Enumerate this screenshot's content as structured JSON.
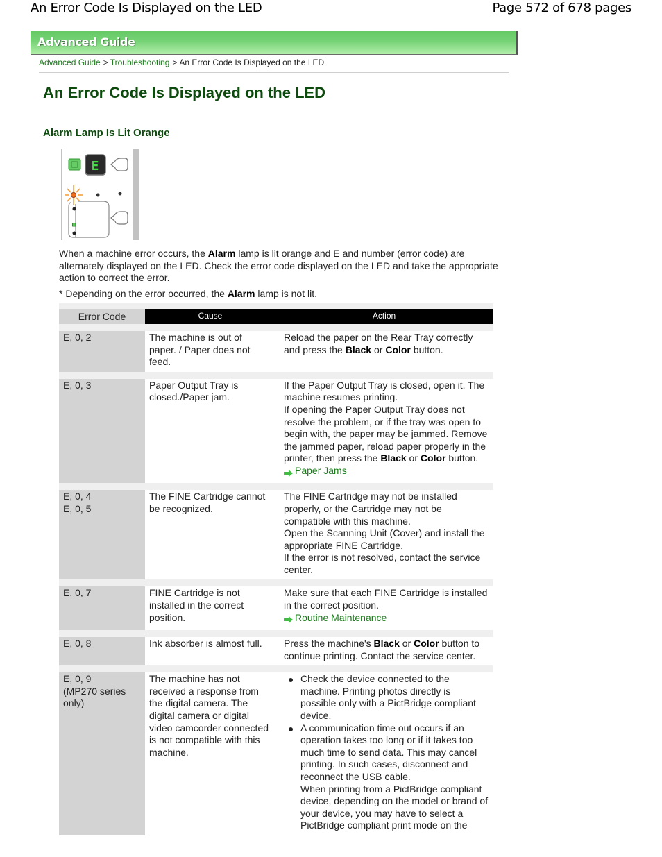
{
  "page_header": {
    "doc_title": "An Error Code Is Displayed on the LED",
    "page_indicator": "Page 572 of 678 pages"
  },
  "banner": {
    "label": "Advanced Guide"
  },
  "breadcrumb": {
    "items": [
      {
        "label": "Advanced Guide",
        "link": true
      },
      {
        "label": "Troubleshooting",
        "link": true
      },
      {
        "label": "An Error Code Is Displayed on the LED",
        "link": false
      }
    ],
    "separator": ">"
  },
  "title": "An Error Code Is Displayed on the LED",
  "section_heading": "Alarm Lamp Is Lit Orange",
  "figure": {
    "description": "Operation panel with Alarm lamp lit orange and LED showing E",
    "led_char": "E",
    "colors": {
      "alarm": "#f07020",
      "power": "#66cc66",
      "led_bg": "#2a2a2a",
      "led_digit": "#44dd44"
    }
  },
  "intro": {
    "p1_before": "When a machine error occurs, the ",
    "p1_bold": "Alarm",
    "p1_after": " lamp is lit orange and E and number (error code) are alternately displayed on the LED. Check the error code displayed on the LED and take the appropriate action to correct the error.",
    "note_before": "* Depending on the error occurred, the ",
    "note_bold": "Alarm",
    "note_after": " lamp is not lit."
  },
  "table": {
    "headers": {
      "code": "Error Code",
      "cause": "Cause",
      "action": "Action"
    },
    "rows": [
      {
        "code": [
          "E, 0, 2"
        ],
        "cause": "The machine is out of paper. / Paper does not feed.",
        "action_parts": [
          {
            "t": "Reload the paper on the Rear Tray correctly and press the "
          },
          {
            "b": "Black"
          },
          {
            "t": " or "
          },
          {
            "b": "Color"
          },
          {
            "t": " button."
          }
        ]
      },
      {
        "code": [
          "E, 0, 3"
        ],
        "cause": "Paper Output Tray is closed./Paper jam.",
        "action_parts": [
          {
            "t": "If the Paper Output Tray is closed, open it. The machine resumes printing."
          },
          {
            "br": true
          },
          {
            "t": "If opening the Paper Output Tray does not resolve the problem, or if the tray was open to begin with, the paper may be jammed. Remove the jammed paper, reload paper properly in the printer, then press the "
          },
          {
            "b": "Black"
          },
          {
            "t": " or "
          },
          {
            "b": "Color"
          },
          {
            "t": " button."
          },
          {
            "br": true
          },
          {
            "link": "Paper Jams"
          }
        ]
      },
      {
        "code": [
          "E, 0, 4",
          "E, 0, 5"
        ],
        "cause": "The FINE Cartridge cannot be recognized.",
        "action_parts": [
          {
            "t": "The FINE Cartridge may not be installed properly, or the Cartridge may not be compatible with this machine."
          },
          {
            "br": true
          },
          {
            "t": "Open the Scanning Unit (Cover) and install the appropriate FINE Cartridge."
          },
          {
            "br": true
          },
          {
            "t": "If the error is not resolved, contact the service center."
          }
        ]
      },
      {
        "code": [
          "E, 0, 7"
        ],
        "cause": "FINE Cartridge is not installed in the correct position.",
        "action_parts": [
          {
            "t": "Make sure that each FINE Cartridge is installed in the correct position."
          },
          {
            "br": true
          },
          {
            "link": "Routine Maintenance"
          }
        ]
      },
      {
        "code": [
          "E, 0, 8"
        ],
        "cause": "Ink absorber is almost full.",
        "action_parts": [
          {
            "t": "Press the machine's "
          },
          {
            "b": "Black"
          },
          {
            "t": " or "
          },
          {
            "b": "Color"
          },
          {
            "t": " button to continue printing. Contact the service center."
          }
        ]
      },
      {
        "code": [
          "E, 0, 9",
          "(MP270 series only)"
        ],
        "cause": "The machine has not received a response from the digital camera. The digital camera or digital video camcorder connected is not compatible with this machine.",
        "action_list": [
          "Check the device connected to the machine. Printing photos directly is possible only with a PictBridge compliant device.",
          "A communication time out occurs if an operation takes too long or if it takes too much time to send data. This may cancel printing. In such cases, disconnect and reconnect the USB cable.\nWhen printing from a PictBridge compliant device, depending on the model or brand of your device, you may have to select a PictBridge compliant print mode on the"
        ]
      }
    ]
  },
  "colors": {
    "heading_green": "#0d4a0d",
    "link_green": "#1a7a1a",
    "banner_green": "#63c963",
    "code_cell_gray": "#d3d3d3",
    "header_black": "#000000"
  }
}
